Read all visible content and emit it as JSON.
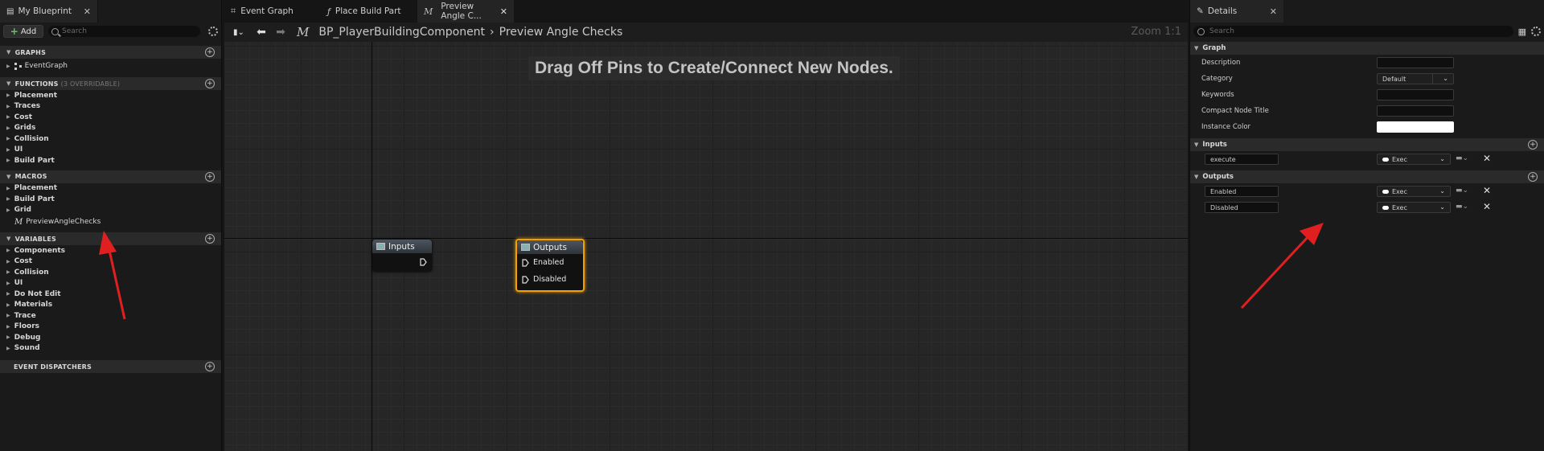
{
  "left": {
    "tab_title": "My Blueprint",
    "add_label": "Add",
    "search_placeholder": "Search",
    "sections": {
      "graphs": {
        "label": "GRAPHS",
        "items": [
          "EventGraph"
        ]
      },
      "functions": {
        "label": "FUNCTIONS",
        "sub": "(3 OVERRIDABLE)",
        "items": [
          "Placement",
          "Traces",
          "Cost",
          "Grids",
          "Collision",
          "UI",
          "Build Part"
        ]
      },
      "macros": {
        "label": "MACROS",
        "items": [
          "Placement",
          "Build Part",
          "Grid"
        ],
        "macro_item": "PreviewAngleChecks"
      },
      "variables": {
        "label": "VARIABLES",
        "items": [
          "Components",
          "Cost",
          "Collision",
          "UI",
          "Do Not Edit",
          "Materials",
          "Trace",
          "Floors",
          "Debug",
          "Sound"
        ]
      },
      "dispatchers": {
        "label": "EVENT DISPATCHERS"
      }
    }
  },
  "graph": {
    "tabs": [
      "Event Graph",
      "Place Build Part",
      "Preview Angle C..."
    ],
    "breadcrumb_root": "BP_PlayerBuildingComponent",
    "breadcrumb_leaf": "Preview Angle Checks",
    "zoom": "Zoom 1:1",
    "hint": "Drag Off Pins to Create/Connect New Nodes.",
    "inputs_node": {
      "title": "Inputs"
    },
    "outputs_node": {
      "title": "Outputs",
      "pins": [
        "Enabled",
        "Disabled"
      ]
    }
  },
  "details": {
    "tab_title": "Details",
    "search_placeholder": "Search",
    "graph_section": "Graph",
    "props": {
      "description": "Description",
      "category": "Category",
      "category_value": "Default",
      "keywords": "Keywords",
      "compact": "Compact Node Title",
      "instance_color": "Instance Color"
    },
    "inputs_section": "Inputs",
    "inputs": [
      {
        "name": "execute",
        "type": "Exec"
      }
    ],
    "outputs_section": "Outputs",
    "outputs": [
      {
        "name": "Enabled",
        "type": "Exec"
      },
      {
        "name": "Disabled",
        "type": "Exec"
      }
    ]
  },
  "colors": {
    "selection": "#f0a000",
    "arrow": "#e02020",
    "accent_add": "#5bc85b"
  }
}
